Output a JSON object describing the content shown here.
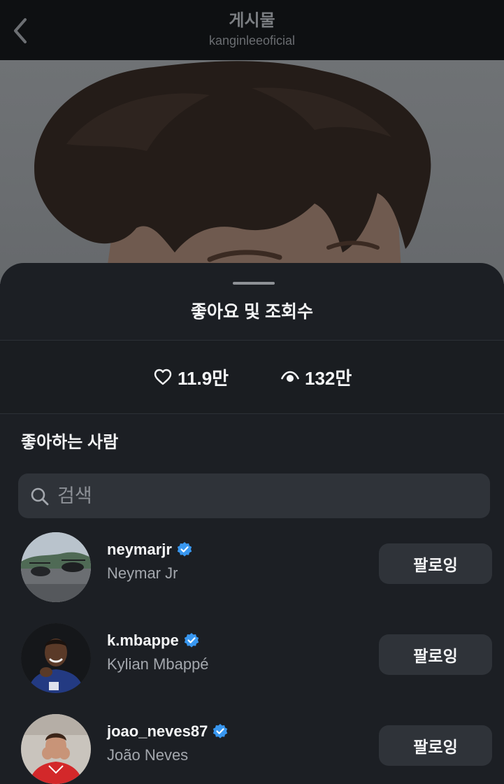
{
  "header": {
    "title": "게시물",
    "subtitle": "kanginleeoficial"
  },
  "sheet": {
    "title": "좋아요 및 조회수",
    "likes": "11.9만",
    "views": "132만",
    "section_title": "좋아하는 사람",
    "search_placeholder": "검색"
  },
  "users": [
    {
      "username": "neymarjr",
      "full_name": "Neymar Jr",
      "verified": true,
      "button": "팔로잉"
    },
    {
      "username": "k.mbappe",
      "full_name": "Kylian Mbappé",
      "verified": true,
      "button": "팔로잉"
    },
    {
      "username": "joao_neves87",
      "full_name": "João Neves",
      "verified": true,
      "button": "팔로잉"
    }
  ],
  "icons": {
    "back": "chevron-left-icon",
    "likes": "heart-icon",
    "views": "eye-icon",
    "search": "search-icon",
    "verified": "verified-badge-icon"
  },
  "colors": {
    "sheet_bg": "#1c1f24",
    "button_bg": "#2f3339",
    "verified_blue": "#3897f0",
    "secondary_text": "#a3a7ad"
  }
}
